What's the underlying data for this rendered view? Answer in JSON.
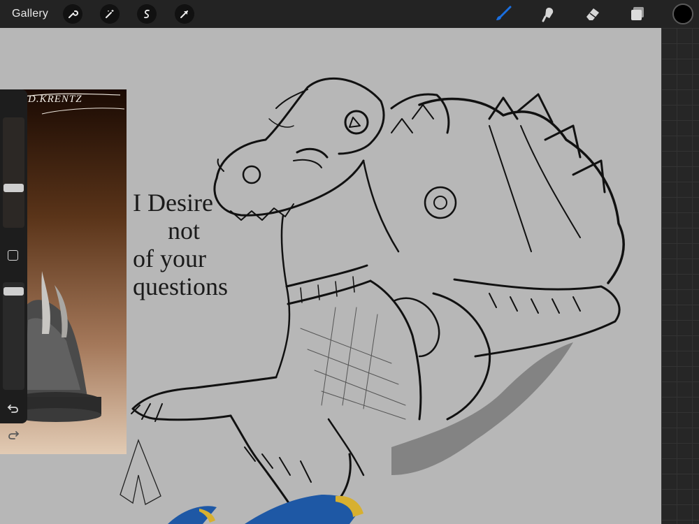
{
  "toolbar": {
    "gallery_label": "Gallery",
    "left_tools": [
      "wrench-icon",
      "magic-wand-icon",
      "selection-icon",
      "transform-arrow-icon"
    ],
    "right_tools": [
      "brush-icon",
      "smudge-icon",
      "eraser-icon",
      "layers-icon"
    ],
    "active_tool": "brush-icon",
    "active_color": "#1a6fe0",
    "current_color": "#000000"
  },
  "reference_image": {
    "signature": "D.KRENTZ"
  },
  "sidebar": {
    "brush_size_level": 0.35,
    "opacity_level": 0.95,
    "undo_icon": "undo-icon",
    "redo_icon": "redo-icon"
  },
  "canvas": {
    "handwriting": [
      "I Desire",
      "not",
      "of your",
      "questions"
    ]
  }
}
